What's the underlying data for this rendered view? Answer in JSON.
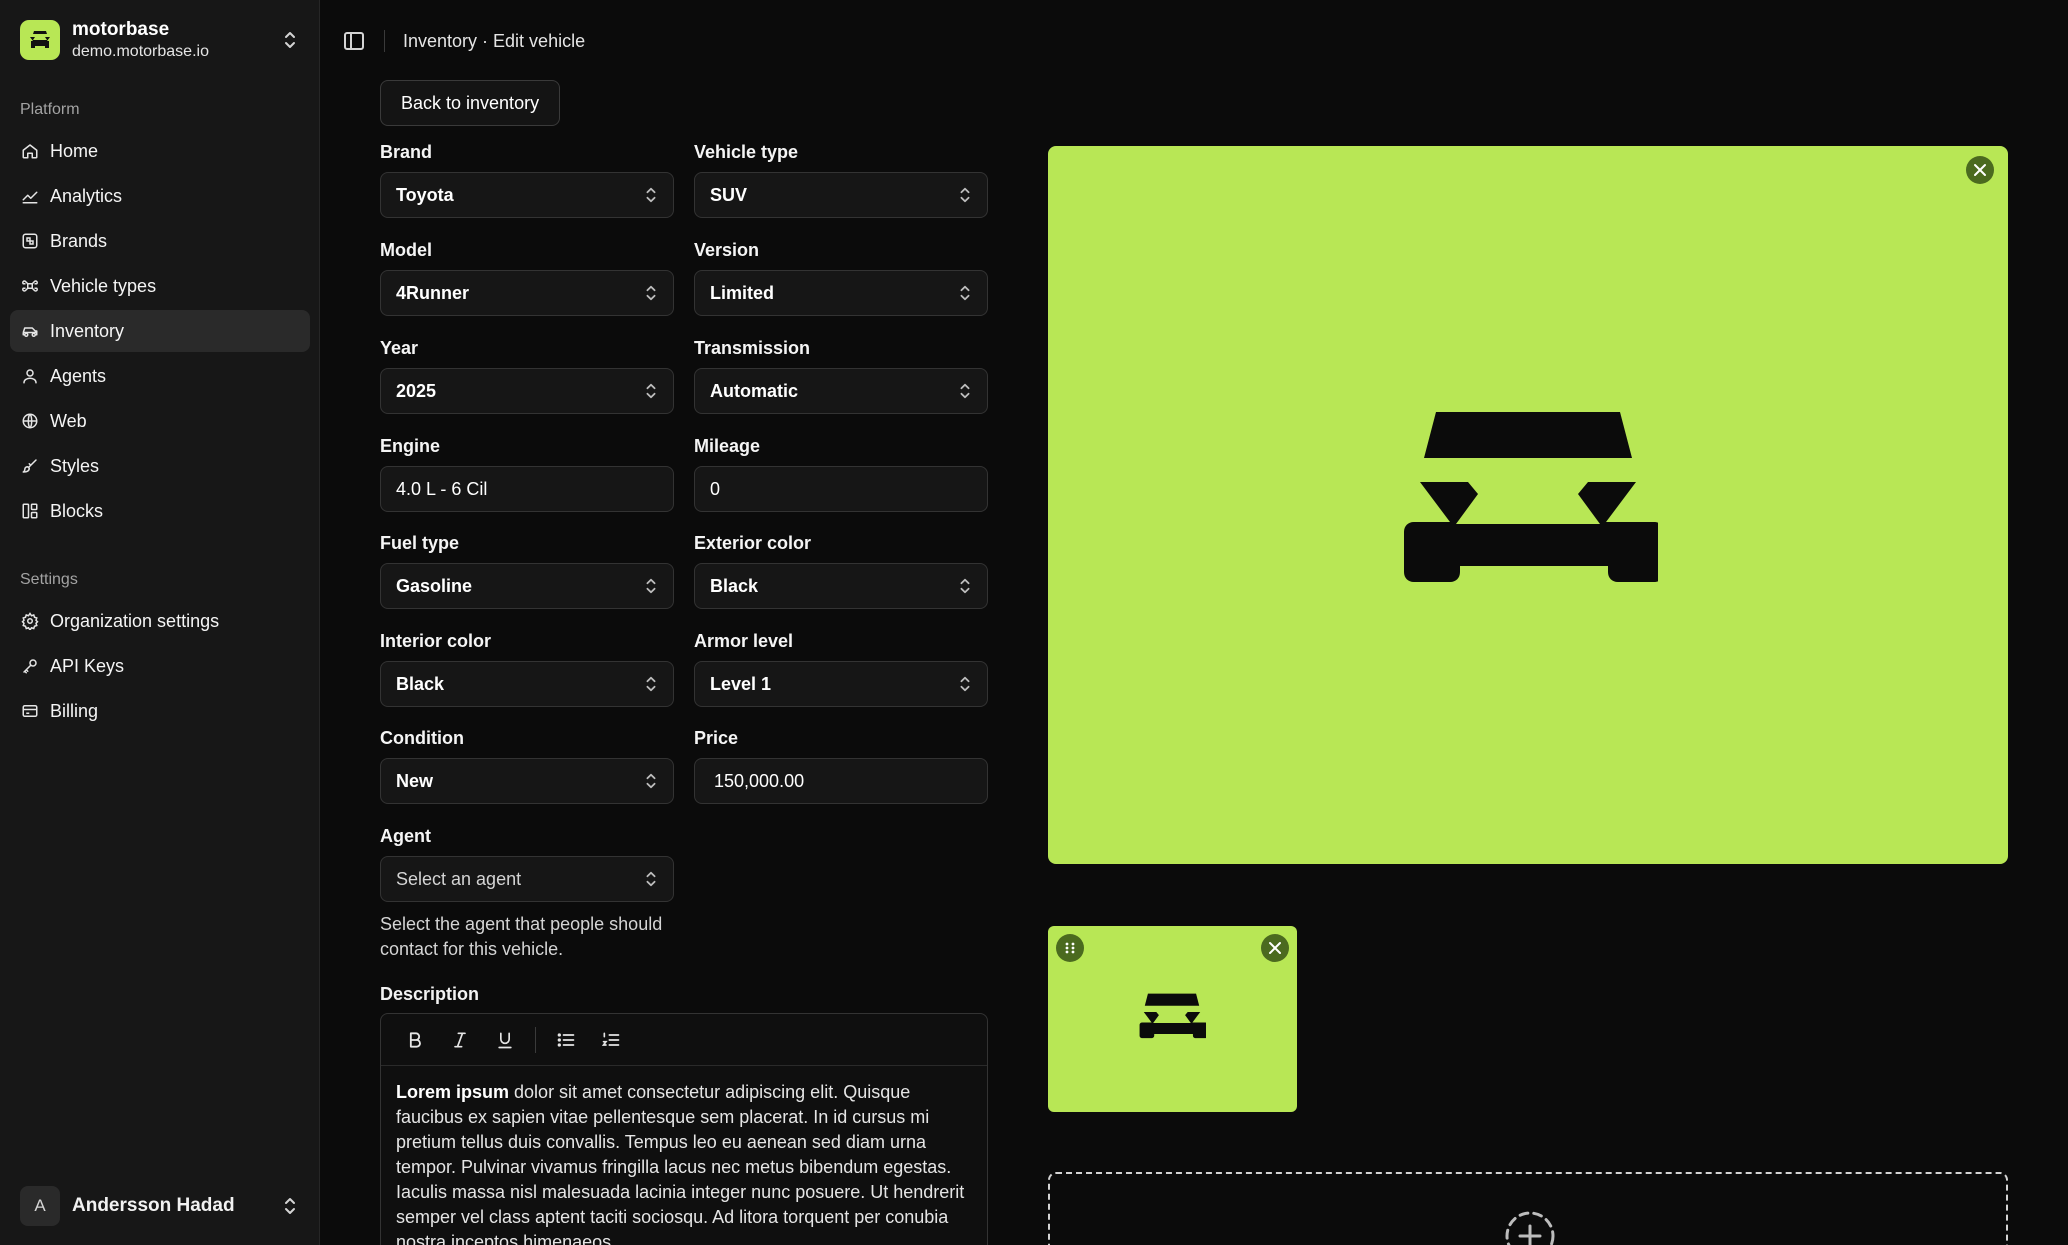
{
  "org": {
    "name": "motorbase",
    "domain": "demo.motorbase.io"
  },
  "sidebar": {
    "platform_label": "Platform",
    "platform_items": [
      {
        "label": "Home",
        "icon": "home-icon"
      },
      {
        "label": "Analytics",
        "icon": "analytics-icon"
      },
      {
        "label": "Brands",
        "icon": "brands-icon"
      },
      {
        "label": "Vehicle types",
        "icon": "vehicle-types-icon"
      },
      {
        "label": "Inventory",
        "icon": "inventory-icon",
        "active": true
      },
      {
        "label": "Agents",
        "icon": "agents-icon"
      },
      {
        "label": "Web",
        "icon": "globe-icon"
      },
      {
        "label": "Styles",
        "icon": "brush-icon"
      },
      {
        "label": "Blocks",
        "icon": "blocks-icon"
      }
    ],
    "settings_label": "Settings",
    "settings_items": [
      {
        "label": "Organization settings",
        "icon": "gear-icon"
      },
      {
        "label": "API Keys",
        "icon": "key-icon"
      },
      {
        "label": "Billing",
        "icon": "billing-icon"
      }
    ]
  },
  "user": {
    "initial": "A",
    "name": "Andersson Hadad"
  },
  "header": {
    "breadcrumb": "Inventory · Edit vehicle"
  },
  "form": {
    "back_label": "Back to inventory",
    "brand": {
      "label": "Brand",
      "value": "Toyota"
    },
    "vehicle_type": {
      "label": "Vehicle type",
      "value": "SUV"
    },
    "model": {
      "label": "Model",
      "value": "4Runner"
    },
    "version": {
      "label": "Version",
      "value": "Limited"
    },
    "year": {
      "label": "Year",
      "value": "2025"
    },
    "transmission": {
      "label": "Transmission",
      "value": "Automatic"
    },
    "engine": {
      "label": "Engine",
      "value": "4.0 L - 6 Cil"
    },
    "mileage": {
      "label": "Mileage",
      "value": "0"
    },
    "fuel_type": {
      "label": "Fuel type",
      "value": "Gasoline"
    },
    "exterior_color": {
      "label": "Exterior color",
      "value": "Black"
    },
    "interior_color": {
      "label": "Interior color",
      "value": "Black"
    },
    "armor_level": {
      "label": "Armor level",
      "value": "Level 1"
    },
    "condition": {
      "label": "Condition",
      "value": "New"
    },
    "price": {
      "label": "Price",
      "value": "150,000.00"
    },
    "agent": {
      "label": "Agent",
      "placeholder": "Select an agent",
      "help": "Select the agent that people should contact for this vehicle."
    },
    "description": {
      "label": "Description",
      "bold_lead": "Lorem ipsum",
      "text": " dolor sit amet consectetur adipiscing elit. Quisque faucibus ex sapien vitae pellentesque sem placerat. In id cursus mi pretium tellus duis convallis. Tempus leo eu aenean sed diam urna tempor. Pulvinar vivamus fringilla lacus nec metus bibendum egestas. Iaculis massa nisl malesuada lacinia integer nunc posuere. Ut hendrerit semper vel class aptent taciti sociosqu. Ad litora torquent per conubia nostra inceptos himenaeos."
    }
  },
  "colors": {
    "accent": "#b8e755",
    "background": "#0b0b0b",
    "sidebar": "#171717"
  }
}
